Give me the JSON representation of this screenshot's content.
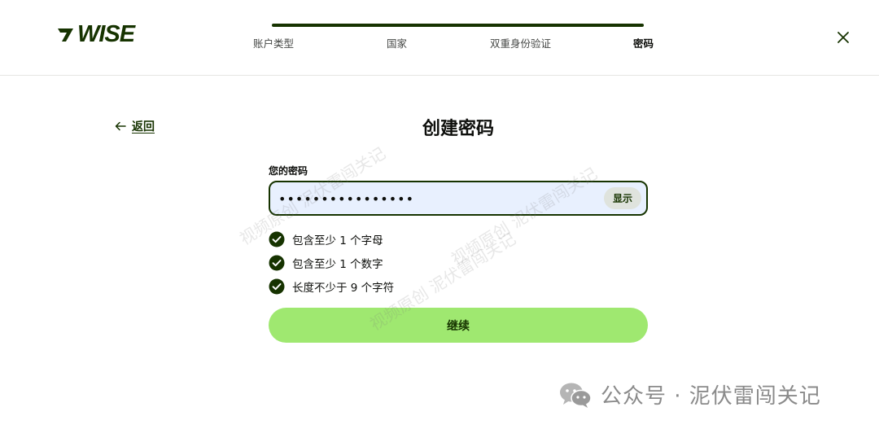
{
  "header": {
    "logo_text": "WISE",
    "steps": [
      {
        "label": "账户类型"
      },
      {
        "label": "国家"
      },
      {
        "label": "双重身份验证"
      },
      {
        "label": "密码",
        "active": true
      }
    ],
    "progress": 1.0
  },
  "nav": {
    "back_label": "返回"
  },
  "main": {
    "title": "创建密码",
    "password_label": "您的密码",
    "password_value": "••••••••••••••••",
    "show_label": "显示",
    "rules": [
      {
        "text": "包含至少 1 个字母",
        "met": true
      },
      {
        "text": "包含至少 1 个数字",
        "met": true
      },
      {
        "text": "长度不少于 9 个字符",
        "met": true
      }
    ],
    "continue_label": "继续"
  },
  "watermarks": [
    "视频原创 泥伏雷闯关记",
    "视频原创 泥伏雷闯关记",
    "视频原创 泥伏雷闯关记"
  ],
  "footer_mark": "公众号 · 泥伏雷闯关记",
  "colors": {
    "brand_dark": "#163300",
    "brand_green": "#9fe870",
    "input_bg": "#e8f0fe"
  }
}
